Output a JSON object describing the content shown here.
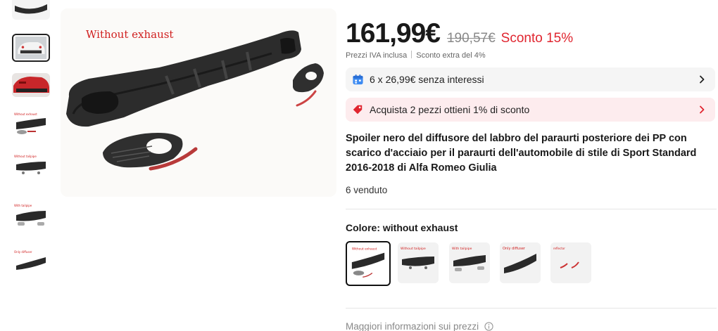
{
  "gallery": {
    "main_caption": "Without exhaust",
    "thumbnails": [
      {
        "label": "partial rear view",
        "selected": false
      },
      {
        "label": "white car rear",
        "selected": true
      },
      {
        "label": "red car rear",
        "selected": false
      },
      {
        "label": "Without exhaust",
        "selected": false
      },
      {
        "label": "Without tailpipe",
        "selected": false
      },
      {
        "label": "With tailpipe",
        "selected": false
      },
      {
        "label": "Only diffuser",
        "selected": false
      }
    ]
  },
  "price": {
    "current": "161,99€",
    "original": "190,57€",
    "discount": "Sconto 15%",
    "vat_note": "Prezzi IVA inclusa",
    "extra_discount": "Sconto extra del 4%"
  },
  "installments": {
    "text": "6 x 26,99€ senza interessi",
    "icon": "calendar-icon"
  },
  "promo": {
    "text": "Acquista 2 pezzi ottieni 1% di sconto",
    "icon": "tag-icon"
  },
  "product": {
    "title": "Spoiler nero del diffusore del labbro del paraurti posteriore dei PP con scarico d'acciaio per il paraurti dell'automobile di stile di Sport Standard 2016-2018 di Alfa Romeo Giulia",
    "sold": "6 venduto"
  },
  "color": {
    "label": "Colore:",
    "selected_value": "without exhaust",
    "options": [
      {
        "name": "Without exhaust",
        "selected": true
      },
      {
        "name": "Without tailpipe",
        "selected": false
      },
      {
        "name": "With tailpipe",
        "selected": false
      },
      {
        "name": "Only diffuser",
        "selected": false
      },
      {
        "name": "reflector",
        "selected": false
      }
    ]
  },
  "more_info": {
    "text": "Maggiori informazioni sui prezzi",
    "icon": "info-icon"
  },
  "colors": {
    "accent_red": "#e0252f",
    "promo_bg": "#fdecee",
    "installments_bg": "#f5f5f5"
  }
}
